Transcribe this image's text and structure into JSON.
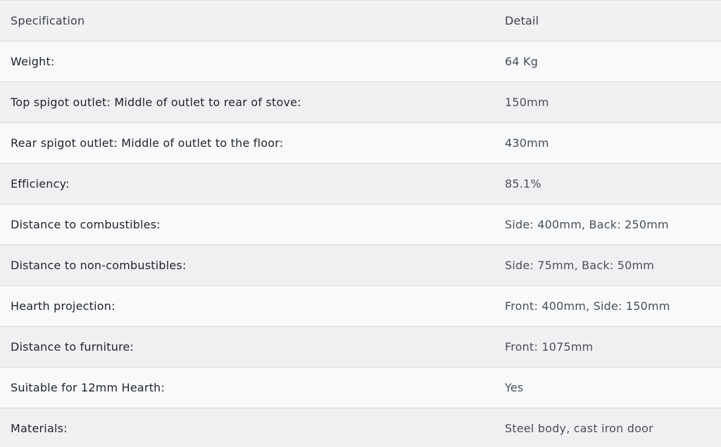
{
  "table": {
    "headers": {
      "specification": "Specification",
      "detail": "Detail"
    },
    "rows": [
      {
        "spec": "Weight:",
        "detail": "64 Kg"
      },
      {
        "spec": "Top spigot outlet: Middle of outlet to rear of stove:",
        "detail": "150mm"
      },
      {
        "spec": "Rear spigot outlet: Middle of outlet to the floor:",
        "detail": "430mm"
      },
      {
        "spec": "Efficiency:",
        "detail": "85.1%"
      },
      {
        "spec": "Distance to combustibles:",
        "detail": "Side: 400mm, Back: 250mm"
      },
      {
        "spec": "Distance to non-combustibles:",
        "detail": "Side: 75mm, Back: 50mm"
      },
      {
        "spec": "Hearth projection:",
        "detail": "Front: 400mm, Side: 150mm"
      },
      {
        "spec": "Distance to furniture:",
        "detail": "Front: 1075mm"
      },
      {
        "spec": "Suitable for 12mm Hearth:",
        "detail": "Yes"
      },
      {
        "spec": "Materials:",
        "detail": "Steel body, cast iron door"
      }
    ]
  },
  "colors": {
    "background": "#f6f6f7",
    "row_odd": "#f8f9fa",
    "row_even": "#f0f0f2",
    "border": "#d9d9dc",
    "text": "#2a2e35"
  }
}
